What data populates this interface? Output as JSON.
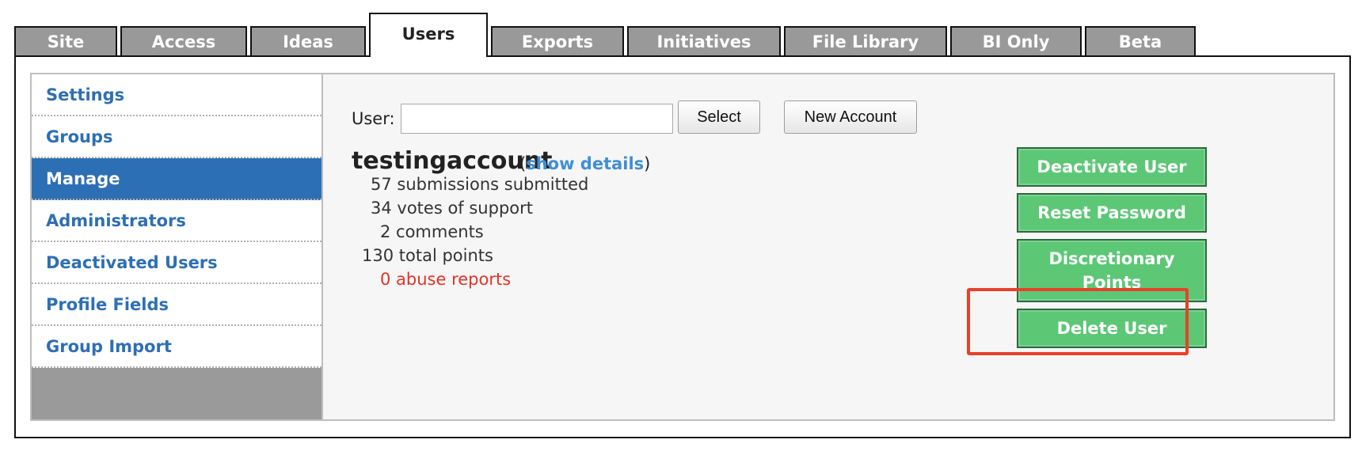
{
  "tabs": [
    {
      "label": "Site"
    },
    {
      "label": "Access"
    },
    {
      "label": "Ideas"
    },
    {
      "label": "Users"
    },
    {
      "label": "Exports"
    },
    {
      "label": "Initiatives"
    },
    {
      "label": "File Library"
    },
    {
      "label": "BI Only"
    },
    {
      "label": "Beta"
    }
  ],
  "sidebar": {
    "items": [
      {
        "label": "Settings"
      },
      {
        "label": "Groups"
      },
      {
        "label": "Manage"
      },
      {
        "label": "Administrators"
      },
      {
        "label": "Deactivated Users"
      },
      {
        "label": "Profile Fields"
      },
      {
        "label": "Group Import"
      }
    ]
  },
  "user_search": {
    "label": "User:",
    "input_value": "",
    "select_label": "Select",
    "new_account_label": "New Account"
  },
  "account": {
    "username": "testingaccount",
    "details_open": "(",
    "details_link": "show details",
    "details_close": ")",
    "stats": [
      "57 submissions submitted",
      "34 votes of support",
      "2 comments",
      "130 total points",
      "0 abuse reports"
    ]
  },
  "actions": {
    "deactivate_label": "Deactivate User",
    "reset_password_label": "Reset Password",
    "discretionary_line1": "Discretionary",
    "discretionary_line2": "Points",
    "delete_label": "Delete User"
  },
  "colors": {
    "accent_blue": "#2d6fb5",
    "action_green": "#5cc775",
    "alert_red": "#e53325",
    "highlight_red": "#e8412a"
  }
}
